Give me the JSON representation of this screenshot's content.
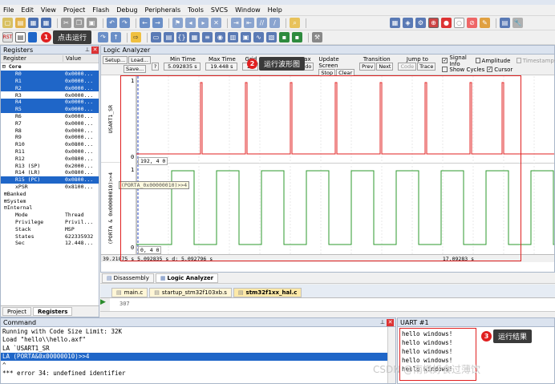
{
  "menu": [
    "File",
    "Edit",
    "View",
    "Project",
    "Flash",
    "Debug",
    "Peripherals",
    "Tools",
    "SVCS",
    "Window",
    "Help"
  ],
  "callouts": {
    "c1": {
      "num": "1",
      "text": "点击运行"
    },
    "c2": {
      "num": "2",
      "text": "运行波形图"
    },
    "c3": {
      "num": "3",
      "text": "运行结果"
    }
  },
  "registers": {
    "title": "Registers",
    "col_register": "Register",
    "col_value": "Value",
    "core_label": "Core",
    "rows": [
      {
        "name": "R0",
        "value": "0x0000...",
        "sel": true
      },
      {
        "name": "R1",
        "value": "0x0000...",
        "sel": true
      },
      {
        "name": "R2",
        "value": "0x0000...",
        "sel": true
      },
      {
        "name": "R3",
        "value": "0x0000...",
        "sel": false
      },
      {
        "name": "R4",
        "value": "0x0000...",
        "sel": true
      },
      {
        "name": "R5",
        "value": "0x0000...",
        "sel": true
      },
      {
        "name": "R6",
        "value": "0x0000...",
        "sel": false
      },
      {
        "name": "R7",
        "value": "0x0000...",
        "sel": false
      },
      {
        "name": "R8",
        "value": "0x0000...",
        "sel": false
      },
      {
        "name": "R9",
        "value": "0x0000...",
        "sel": false
      },
      {
        "name": "R10",
        "value": "0x0800...",
        "sel": false
      },
      {
        "name": "R11",
        "value": "0x0000...",
        "sel": false
      },
      {
        "name": "R12",
        "value": "0x0800...",
        "sel": false
      },
      {
        "name": "R13 (SP)",
        "value": "0x2000...",
        "sel": false
      },
      {
        "name": "R14 (LR)",
        "value": "0x0800...",
        "sel": false
      },
      {
        "name": "R15 (PC)",
        "value": "0x0800...",
        "sel": true
      },
      {
        "name": "xPSR",
        "value": "0x8100...",
        "sel": false
      }
    ],
    "groups": [
      "Banked",
      "System",
      "Internal"
    ],
    "internal": [
      {
        "name": "Mode",
        "value": "Thread"
      },
      {
        "name": "Privilege",
        "value": "Privil..."
      },
      {
        "name": "Stack",
        "value": "MSP"
      },
      {
        "name": "States",
        "value": "622335932"
      },
      {
        "name": "Sec",
        "value": "12.448..."
      }
    ],
    "tab_project": "Project",
    "tab_registers": "Registers"
  },
  "la": {
    "title": "Logic Analyzer",
    "setup": "Setup...",
    "load": "Load...",
    "save": "Save...",
    "q": "?",
    "min_time_h": "Min Time",
    "min_time": "5.092835 s",
    "max_time_h": "Max Time",
    "max_time": "19.448 s",
    "grid_h": "Grid",
    "grid": "1 s",
    "max_h": "Max",
    "undo": "Undo",
    "update_h": "Update Screen",
    "stop": "Stop",
    "clear": "Clear",
    "transition_h": "Transition",
    "prev": "Prev",
    "next": "Next",
    "jump_h": "Jump to",
    "code": "Code",
    "trace": "Trace",
    "signal_info": "Signal Info",
    "amplitude": "Amplitude",
    "timestamps": "Timestamps",
    "show_cycles": "Show Cycles",
    "cursor": "Cursor",
    "sig1_name": "USART1_SR",
    "sig2_name": "(PORTA & 0x00000010)>>4",
    "sig2_tooltip": "(PORTA_0x00000010)>>4",
    "y1": "1",
    "y0": "0",
    "cursor1_val": "192,  4  0",
    "cursor2_val": "0,  4  0",
    "status_left": "39.21875 s",
    "status_mid": "5.092835 s",
    "status_mid2": "d: 5.092796 s",
    "status_right": "17.09283 s"
  },
  "editor_tabs": {
    "disassembly": "Disassembly",
    "logic": "Logic Analyzer",
    "files": [
      "main.c",
      "startup_stm32f103xb.s",
      "stm32f1xx_hal.c"
    ],
    "line": "307"
  },
  "command": {
    "title": "Command",
    "lines": [
      "Running with Code Size Limit: 32K",
      "Load \"hello\\\\hello.axf\"",
      "LA `USART1_SR",
      "LA (PORTA&0x00000010)>>4",
      "   ^",
      "*** error 34: undefined identifier"
    ],
    "selected_index": 3
  },
  "uart": {
    "title": "UART #1",
    "lines": [
      "hello windows!",
      "hello windows!",
      "hello windows!",
      "hello windows!",
      "hello windows!"
    ]
  },
  "watermark": "CSDN @南枫好食过薄饮",
  "colors": {
    "selected": "#1f66c8",
    "signal_red": "#e02020",
    "signal_green": "#2c9a2c",
    "callout_red": "#e02020"
  }
}
